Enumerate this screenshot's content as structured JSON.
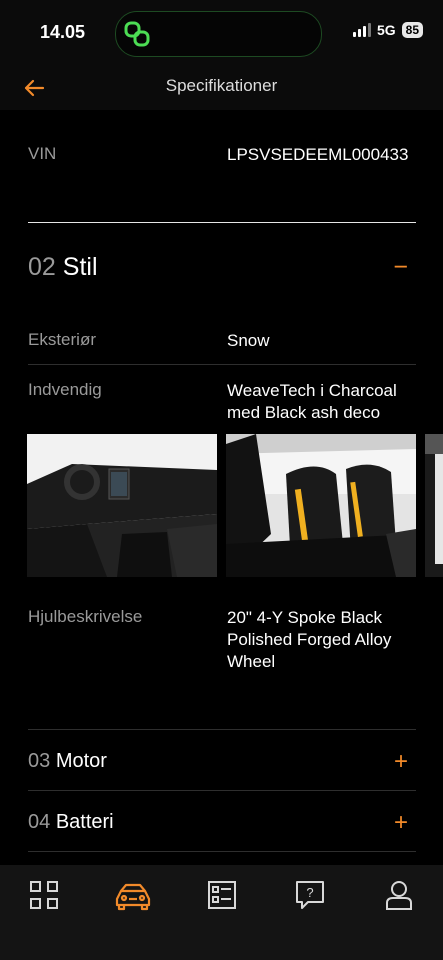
{
  "status": {
    "time": "14.05",
    "network": "5G",
    "battery": "85"
  },
  "header": {
    "title": "Specifikationer"
  },
  "vin": {
    "label": "VIN",
    "value": "LPSVSEDEEML000433"
  },
  "style_section": {
    "number": "02",
    "title": "Stil",
    "toggle": "−"
  },
  "specs": [
    {
      "label": "Eksteriør",
      "value": "Snow"
    },
    {
      "label": "Indvendig",
      "value": "WeaveTech i Charcoal med Black ash deco"
    },
    {
      "label": "Hjulbeskrivelse",
      "value": "20\" 4-Y Spoke Black Polished Forged Alloy Wheel"
    }
  ],
  "sections": [
    {
      "number": "03",
      "title": "Motor",
      "toggle": "+"
    },
    {
      "number": "04",
      "title": "Batteri",
      "toggle": "+"
    }
  ],
  "colors": {
    "accent": "#f28a2a",
    "background": "#000000"
  },
  "tabbar": {
    "icons": [
      "grid-icon",
      "car-icon",
      "spec-sheet-icon",
      "help-icon",
      "profile-icon"
    ],
    "active": "car-icon"
  }
}
